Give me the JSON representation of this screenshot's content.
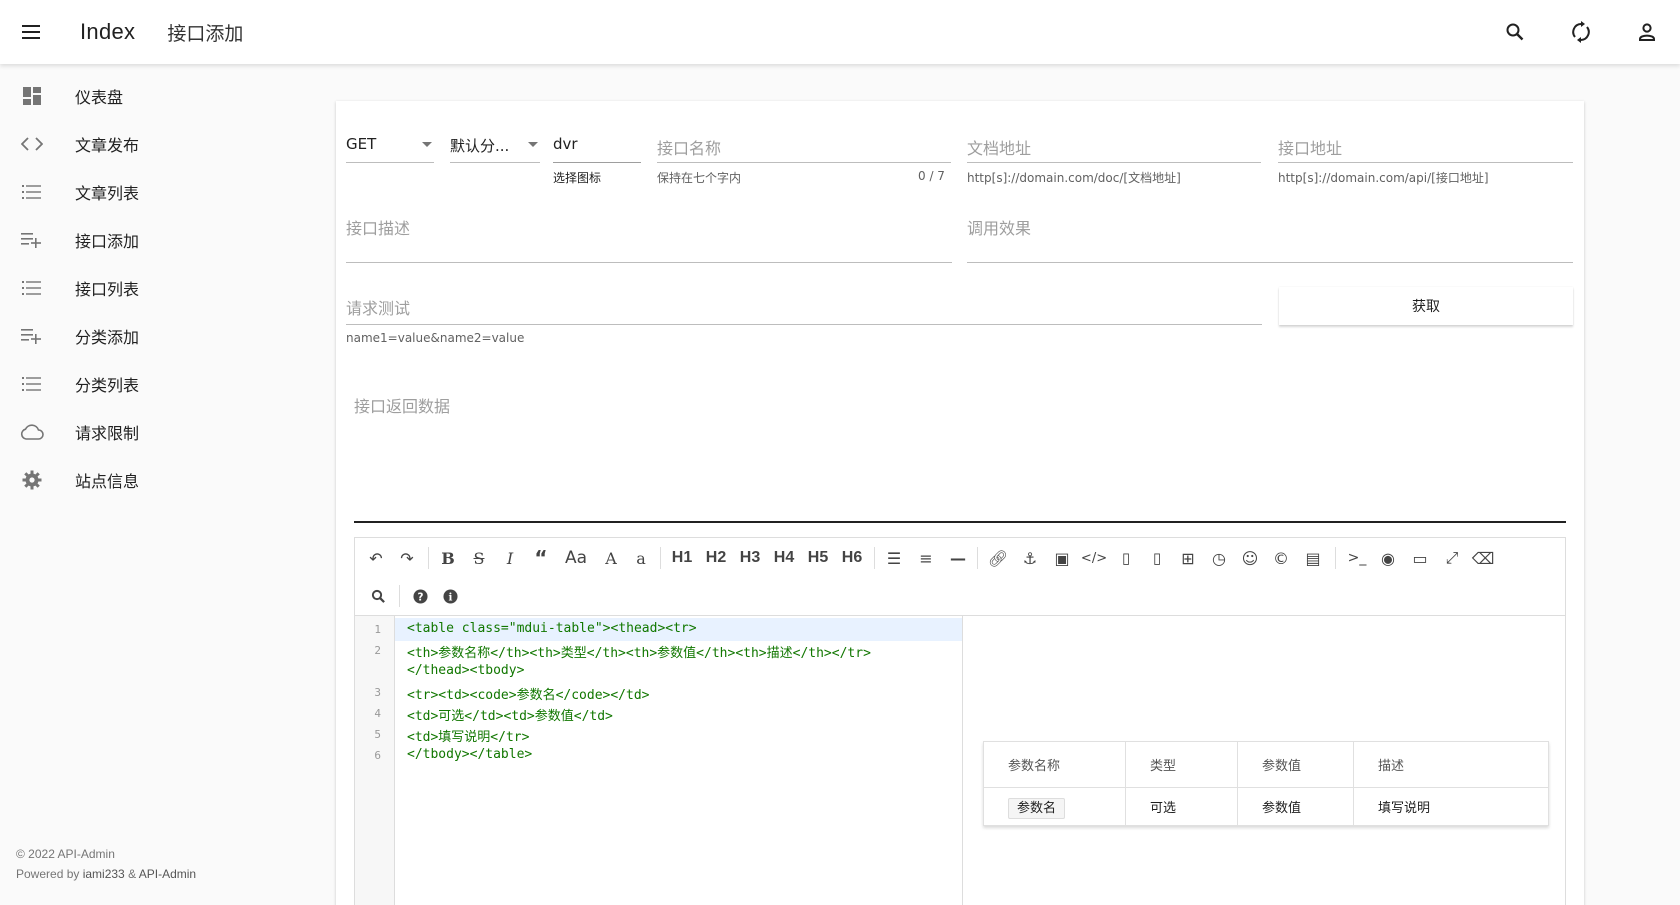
{
  "appbar": {
    "title": "Index",
    "subtitle": "接口添加",
    "icons": [
      "menu-icon",
      "search-icon",
      "refresh-icon",
      "account-icon"
    ]
  },
  "sidebar": {
    "items": [
      {
        "label": "仪表盘",
        "icon": "dashboard-icon"
      },
      {
        "label": "文章发布",
        "icon": "code-icon"
      },
      {
        "label": "文章列表",
        "icon": "list-icon"
      },
      {
        "label": "接口添加",
        "icon": "playlist-add-icon"
      },
      {
        "label": "接口列表",
        "icon": "list-icon"
      },
      {
        "label": "分类添加",
        "icon": "playlist-add-icon"
      },
      {
        "label": "分类列表",
        "icon": "list-icon"
      },
      {
        "label": "请求限制",
        "icon": "cloud-icon"
      },
      {
        "label": "站点信息",
        "icon": "gear-icon"
      }
    ],
    "footer": {
      "copyright": "© 2022 API-Admin",
      "powered_prefix": "Powered by ",
      "powered_by": "iami233",
      "powered_sep": " & ",
      "powered_by2": "API-Admin"
    }
  },
  "form": {
    "method": "GET",
    "category": "默认分...",
    "icon": {
      "value": "dvr",
      "helper": "选择图标"
    },
    "name": {
      "placeholder": "接口名称",
      "helper": "保持在七个字内",
      "counter": "0 / 7"
    },
    "doc_url": {
      "placeholder": "文档地址",
      "helper": "http[s]://domain.com/doc/[文档地址]"
    },
    "api_url": {
      "placeholder": "接口地址",
      "helper": "http[s]://domain.com/api/[接口地址]"
    },
    "description": {
      "placeholder": "接口描述"
    },
    "effect": {
      "placeholder": "调用效果"
    },
    "request_test": {
      "placeholder": "请求测试",
      "helper": "name1=value&name2=value"
    },
    "fetch_button": "获取",
    "response": {
      "placeholder": "接口返回数据"
    }
  },
  "editor": {
    "headings": [
      "H1",
      "H2",
      "H3",
      "H4",
      "H5",
      "H6"
    ],
    "code_lines": [
      {
        "n": "1",
        "text": "<table class=\"mdui-table\"><thead><tr>"
      },
      {
        "n": "2",
        "text": "<th>参数名称</th><th>类型</th><th>参数值</th><th>描述</th></tr>"
      },
      {
        "n": "",
        "text": "</thead><tbody>"
      },
      {
        "n": "3",
        "text": "<tr><td><code>参数名</code></td>"
      },
      {
        "n": "4",
        "text": "<td>可选</td><td>参数值</td>"
      },
      {
        "n": "5",
        "text": "<td>填写说明</tr>"
      },
      {
        "n": "6",
        "text": "</tbody></table>"
      }
    ],
    "preview": {
      "headers": [
        "参数名称",
        "类型",
        "参数值",
        "描述"
      ],
      "row": [
        "参数名",
        "可选",
        "参数值",
        "填写说明"
      ]
    }
  }
}
